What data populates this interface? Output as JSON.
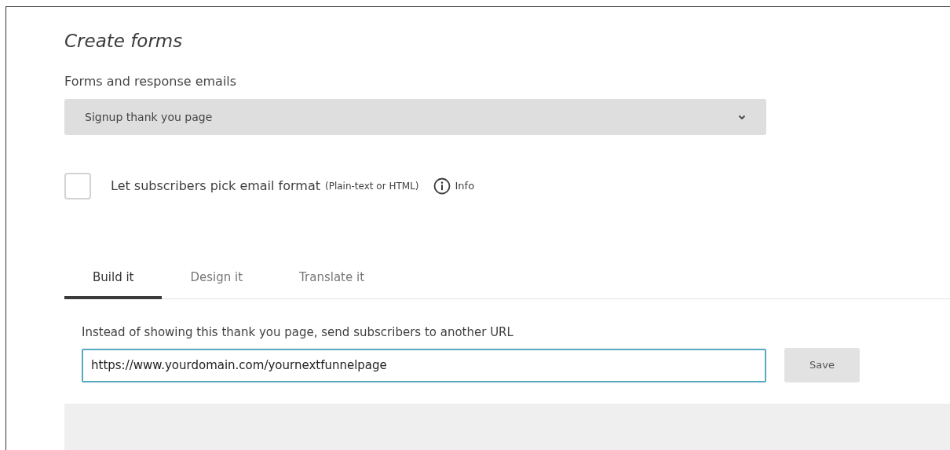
{
  "title": "Create forms",
  "forms_select": {
    "label": "Forms and response emails",
    "value": "Signup thank you page"
  },
  "format_option": {
    "label": "Let subscribers pick email format",
    "note": "(Plain-text or HTML)",
    "checked": false,
    "info": "Info"
  },
  "tabs": [
    {
      "label": "Build it",
      "selected": true
    },
    {
      "label": "Design it",
      "selected": false
    },
    {
      "label": "Translate it",
      "selected": false
    }
  ],
  "redirect": {
    "label": "Instead of showing this thank you page, send subscribers to another URL",
    "value": "https://www.yourdomain.com/yournextfunnelpage",
    "button": "Save"
  }
}
